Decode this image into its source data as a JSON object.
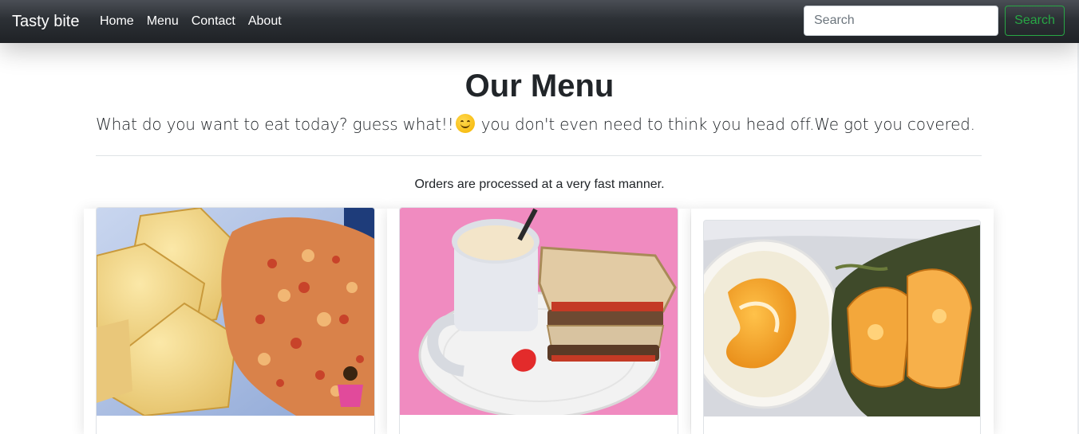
{
  "navbar": {
    "brand": "Tasty bite",
    "links": [
      "Home",
      "Menu",
      "Contact",
      "About"
    ],
    "search": {
      "placeholder": "Search",
      "button_label": "Search"
    }
  },
  "main": {
    "title": "Our Menu",
    "lead_before": "What do you want to eat today? guess what!!",
    "lead_after": " you don't even need to think you head off.We got you covered.",
    "note": "Orders are processed at a very fast manner."
  },
  "cards": [
    {
      "image": "yam-and-egg-sauce"
    },
    {
      "image": "tea-and-sandwich"
    },
    {
      "image": "pap-and-moi-moi"
    }
  ]
}
